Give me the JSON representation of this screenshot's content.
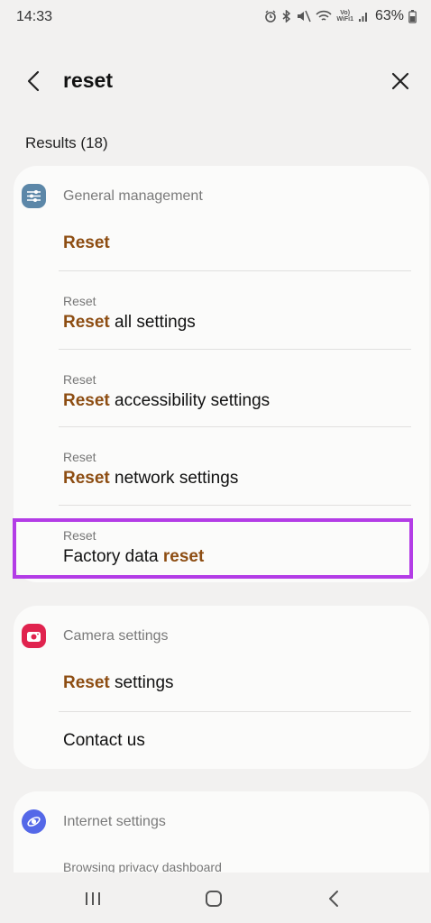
{
  "status_bar": {
    "time": "14:33",
    "battery": "63%",
    "icons": [
      "alarm-icon",
      "bluetooth-icon",
      "mute-icon",
      "wifi-icon",
      "vowifi-icon",
      "signal-icon",
      "battery-icon"
    ],
    "vowifi_label": "VoLTE"
  },
  "search": {
    "query": "reset"
  },
  "results_label": "Results (18)",
  "sections": [
    {
      "title": "General management",
      "icon": "sliders-icon",
      "icon_color": "#5c87a8",
      "items": [
        {
          "crumb": "",
          "title_pre": "",
          "title_hl": "Reset",
          "title_post": ""
        },
        {
          "crumb": "Reset",
          "title_pre": "",
          "title_hl": "Reset",
          "title_post": " all settings"
        },
        {
          "crumb": "Reset",
          "title_pre": "",
          "title_hl": "Reset",
          "title_post": " accessibility settings"
        },
        {
          "crumb": "Reset",
          "title_pre": "",
          "title_hl": "Reset",
          "title_post": " network settings"
        },
        {
          "crumb": "Reset",
          "title_pre": "Factory data ",
          "title_hl": "reset",
          "title_post": ""
        }
      ]
    },
    {
      "title": "Camera settings",
      "icon": "camera-icon",
      "icon_color": "#e0234e",
      "items": [
        {
          "crumb": "",
          "title_pre": "",
          "title_hl": "Reset",
          "title_post": " settings"
        },
        {
          "crumb": "",
          "title_pre": "Contact us",
          "title_hl": "",
          "title_post": ""
        }
      ]
    },
    {
      "title": "Internet settings",
      "icon": "internet-icon",
      "icon_color": "#5468e8",
      "items": [
        {
          "crumb": "",
          "title_pre": "Browsing privacy dashboard",
          "title_hl": "",
          "title_post": ""
        }
      ]
    }
  ],
  "colors": {
    "highlight_text": "#8d4d12",
    "annotation_box": "#b33ce6",
    "background": "#f2f1f0",
    "card": "#fbfbfa"
  }
}
